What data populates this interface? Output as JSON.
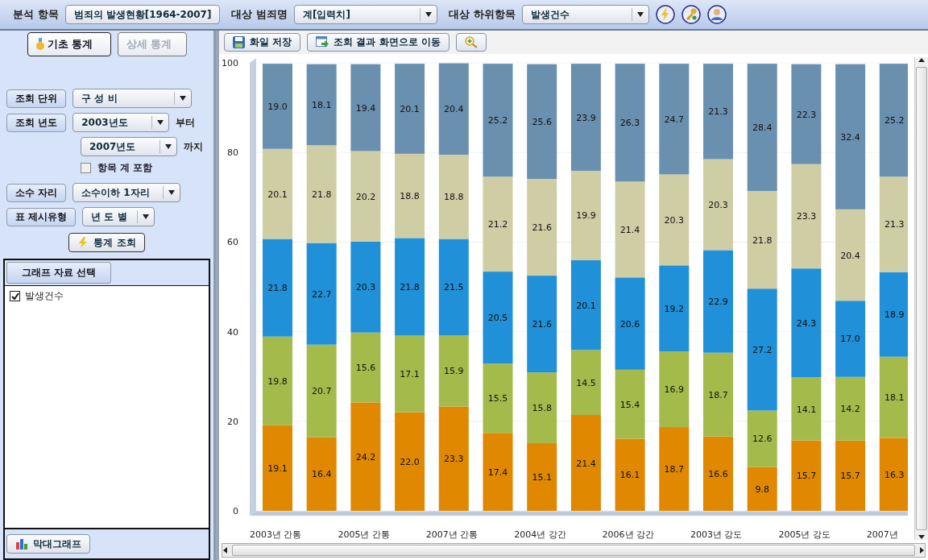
{
  "toolbar": {
    "fields": [
      {
        "label": "분석 항목",
        "value": "범죄의 발생현황[1964-2007]",
        "kind": "button"
      },
      {
        "label": "대상 범죄명",
        "value": "계[입력치]",
        "kind": "dropdown"
      },
      {
        "label": "대상 하위항목",
        "value": "발생건수",
        "kind": "dropdown"
      }
    ]
  },
  "stat_tabs": [
    {
      "label": "기초 통계",
      "selected": true
    },
    {
      "label": "상세 통계",
      "selected": false
    }
  ],
  "query_unit": {
    "label": "조회 단위",
    "value": "구 성 비"
  },
  "query_year": {
    "label": "조회 년도",
    "from": {
      "value": "2003년도",
      "suffix": "부터"
    },
    "to": {
      "value": "2007년도",
      "suffix": "까지"
    }
  },
  "include_total": {
    "label": "항목 계 포함",
    "checked": false
  },
  "decimal": {
    "label": "소수 자리",
    "value": "소수이하 1자리"
  },
  "table_type": {
    "label": "표 제시유형",
    "value": "년 도 별"
  },
  "query_button": "통계 조회",
  "graph_select": {
    "title": "그래프 자료 선택",
    "items": [
      {
        "label": "발생건수",
        "checked": true
      }
    ]
  },
  "graph_button": "막대그래프",
  "chart_toolbar": [
    "화일 저장",
    "조회 결과 화면으로 이동"
  ],
  "chart_data": {
    "type": "bar",
    "stacked": true,
    "grid": true,
    "categories": [
      "2003년 간통",
      null,
      "2005년 간통",
      null,
      "2007년 간통",
      null,
      "2004년 강간",
      null,
      "2006년 강간",
      null,
      "2003년 강도",
      null,
      "2005년 강도",
      null,
      "2007년"
    ],
    "value_labels": [
      [
        "19.1",
        "16.4",
        "24.2",
        "22.0",
        "23.3",
        "17.4",
        "15.1",
        "21.4",
        "16.1",
        "18.7",
        "16.6",
        "9.8",
        "15.7",
        "15.7",
        "16.3"
      ],
      [
        "19.8",
        "20.7",
        "15.6",
        "17.1",
        "15.9",
        "15.5",
        "15.8",
        "14.5",
        "15.4",
        "16.9",
        "18.7",
        "12.6",
        "14.1",
        "14.2",
        "18.1"
      ],
      [
        "21.8",
        "22.7",
        "20.3",
        "21.8",
        "21.5",
        "20.5",
        "21.6",
        "20.1",
        "20.6",
        "19.2",
        "22.9",
        "27.2",
        "24.3",
        "17.0",
        "18.9"
      ],
      [
        "20.1",
        "21.8",
        "20.2",
        "18.8",
        "18.8",
        "21.2",
        "21.6",
        "19.9",
        "21.4",
        "20.3",
        "20.3",
        "21.8",
        "23.3",
        "20.4",
        "21.3"
      ],
      [
        "19.0",
        "18.1",
        "19.4",
        "20.1",
        "20.4",
        "25.2",
        "25.6",
        "23.9",
        "26.3",
        "24.7",
        "21.3",
        "28.4",
        "22.3",
        "32.4",
        "25.2"
      ]
    ],
    "ylim": [
      0,
      100
    ],
    "yticks": [
      0,
      20,
      40,
      60,
      80,
      100
    ],
    "series": [
      {
        "color": "#e08800",
        "values": [
          19.1,
          16.4,
          24.2,
          22.0,
          23.3,
          17.4,
          15.1,
          21.4,
          16.1,
          18.7,
          16.6,
          9.8,
          15.7,
          15.7,
          16.3
        ]
      },
      {
        "color": "#a4bb4c",
        "values": [
          19.8,
          20.7,
          15.6,
          17.1,
          15.9,
          15.5,
          15.8,
          14.5,
          15.4,
          16.9,
          18.7,
          12.6,
          14.1,
          14.2,
          18.1
        ]
      },
      {
        "color": "#2090d8",
        "values": [
          21.8,
          22.7,
          20.3,
          21.8,
          21.5,
          20.5,
          21.6,
          20.1,
          20.6,
          19.2,
          22.9,
          27.2,
          24.3,
          17.0,
          18.9
        ]
      },
      {
        "color": "#cfcda4",
        "values": [
          20.1,
          21.8,
          20.2,
          18.8,
          18.8,
          21.2,
          21.6,
          19.9,
          21.4,
          20.3,
          20.3,
          21.8,
          23.3,
          20.4,
          21.3
        ]
      },
      {
        "color": "#6a90b0",
        "values": [
          19.0,
          18.1,
          19.4,
          20.1,
          20.4,
          25.2,
          25.6,
          23.9,
          26.3,
          24.7,
          21.3,
          28.4,
          22.3,
          32.4,
          25.2
        ]
      }
    ]
  }
}
